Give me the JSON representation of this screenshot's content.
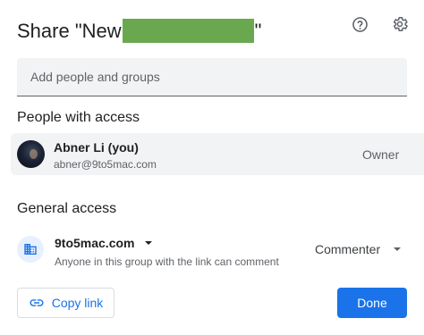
{
  "dialog": {
    "title_prefix": "Share \"New",
    "title_suffix": "\"",
    "help_icon": "help-circle-icon",
    "settings_icon": "gear-icon"
  },
  "add_people": {
    "placeholder": "Add people and groups",
    "value": ""
  },
  "people_section": {
    "heading": "People with access",
    "people": [
      {
        "name": "Abner Li (you)",
        "email": "abner@9to5mac.com",
        "role": "Owner"
      }
    ]
  },
  "general_access": {
    "heading": "General access",
    "domain": "9to5mac.com",
    "description": "Anyone in this group with the link can comment",
    "role": "Commenter",
    "icon": "domain-building-icon"
  },
  "footer": {
    "copy_link_label": "Copy link",
    "done_label": "Done"
  },
  "colors": {
    "accent": "#1a73e8",
    "redaction": "#6aa84f"
  }
}
